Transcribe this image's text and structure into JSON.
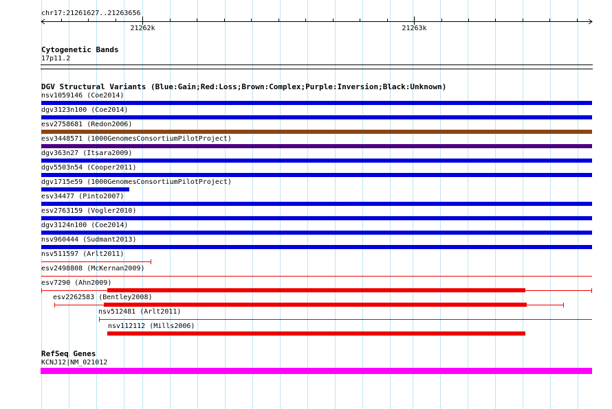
{
  "ruler": {
    "location": "chr17:21261627..21263656",
    "ticks": [
      {
        "label": "21262k",
        "position": 21262000
      },
      {
        "label": "21263k",
        "position": 21263000
      }
    ],
    "start": 21261627,
    "end": 21263656
  },
  "cytoband": {
    "title": "Cytogenetic Bands",
    "band": "17p11.2"
  },
  "dgv": {
    "title": "DGV Structural Variants (Blue:Gain;Red:Loss;Brown:Complex;Purple:Inversion;Black:Unknown)",
    "colors": {
      "gain": "#0000dd",
      "loss": "#ee0000",
      "complex": "#8b4513",
      "inversion": "#4b0082",
      "unknown": "#000000"
    },
    "variants": [
      {
        "label": "nsv1059146 (Coe2014)",
        "type": "gain",
        "start": 21261627,
        "end": 21263656,
        "thick": true
      },
      {
        "label": "dgv3123n100 (Coe2014)",
        "type": "gain",
        "start": 21261627,
        "end": 21263656,
        "thick": true
      },
      {
        "label": "esv2758681 (Redon2006)",
        "type": "complex",
        "start": 21261627,
        "end": 21263656,
        "thick": true
      },
      {
        "label": "esv3448571 (1000GenomesConsortiumPilotProject)",
        "type": "inversion",
        "start": 21261627,
        "end": 21263656,
        "thick": true
      },
      {
        "label": "dgv363n27 (Itsara2009)",
        "type": "gain",
        "start": 21261627,
        "end": 21263656,
        "thick": true
      },
      {
        "label": "dgv5503n54 (Cooper2011)",
        "type": "gain",
        "start": 21261627,
        "end": 21263656,
        "thick": true
      },
      {
        "label": "dgv1715e59 (1000GenomesConsortiumPilotProject)",
        "type": "gain",
        "start": 21261627,
        "end": 21261950,
        "thick": true
      },
      {
        "label": "esv34477 (Pinto2007)",
        "type": "gain",
        "start": 21261627,
        "end": 21263656,
        "thick": true
      },
      {
        "label": "esv2763159 (Vogler2010)",
        "type": "gain",
        "start": 21261627,
        "end": 21263656,
        "thick": true
      },
      {
        "label": "dgv3124n100 (Coe2014)",
        "type": "gain",
        "start": 21261627,
        "end": 21263656,
        "thick": true
      },
      {
        "label": "nsv960444 (Sudmant2013)",
        "type": "gain",
        "start": 21261627,
        "end": 21263656,
        "thick": true
      },
      {
        "label": "nsv511597 (Arlt2011)",
        "type": "loss",
        "start": 21261627,
        "end": 21262032,
        "thick": false,
        "endcaps": "right"
      },
      {
        "label": "esv2498808 (McKernan2009)",
        "type": "loss",
        "start": 21261627,
        "end": 21263656,
        "thick": false
      },
      {
        "label": "esv7290 (Ahn2009)",
        "type": "loss",
        "start": 21261627,
        "end": 21263656,
        "thick": false,
        "endcaps": "both",
        "inner_start": 21261870,
        "inner_end": 21263410
      },
      {
        "label": "esv2262583 (Bentley2008)",
        "type": "loss",
        "start": 21261675,
        "end": 21263552,
        "thick": false,
        "endcaps": "both",
        "inner_start": 21261858,
        "inner_end": 21263415
      },
      {
        "label": "nsv512481 (Arlt2011)",
        "type": "loss",
        "start": 21261840,
        "end": 21263656,
        "thick": false,
        "endcaps": "left"
      },
      {
        "label": "nsv112112 (Mills2006)",
        "type": "loss",
        "start": 21261870,
        "end": 21263410,
        "thick": true
      }
    ]
  },
  "refseq": {
    "title": "RefSeq Genes",
    "genes": [
      {
        "label": "KCNJ12|NM_021012",
        "start": 21261627,
        "end": 21263656,
        "color": "#ff00ff"
      }
    ]
  }
}
